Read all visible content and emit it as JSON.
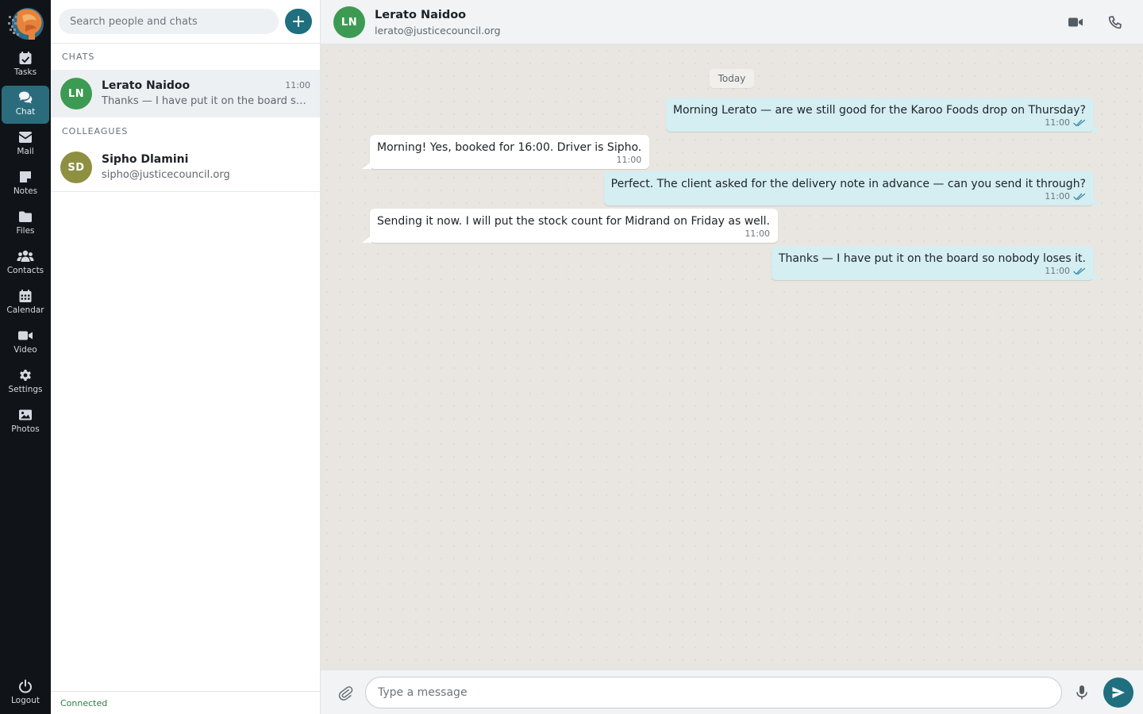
{
  "nav": {
    "items": [
      {
        "label": "Tasks",
        "icon": "tasks-icon"
      },
      {
        "label": "Chat",
        "icon": "chat-icon",
        "active": true
      },
      {
        "label": "Mail",
        "icon": "mail-icon"
      },
      {
        "label": "Notes",
        "icon": "notes-icon"
      },
      {
        "label": "Files",
        "icon": "folder-icon"
      },
      {
        "label": "Contacts",
        "icon": "contacts-icon"
      },
      {
        "label": "Calendar",
        "icon": "calendar-icon"
      },
      {
        "label": "Video",
        "icon": "video-icon"
      },
      {
        "label": "Settings",
        "icon": "gear-icon"
      },
      {
        "label": "Photos",
        "icon": "image-icon"
      }
    ],
    "logout_label": "Logout"
  },
  "list": {
    "search_placeholder": "Search people and chats",
    "chats_heading": "CHATS",
    "colleagues_heading": "COLLEAGUES",
    "chats": [
      {
        "initials": "LN",
        "name": "Lerato Naidoo",
        "time": "11:00",
        "preview": "Thanks — I have put it on the board so nobody loses it.",
        "avatar_color": "#3d9a52"
      }
    ],
    "colleagues": [
      {
        "initials": "SD",
        "name": "Sipho Dlamini",
        "email": "sipho@justicecouncil.org",
        "avatar_color": "#8f8f42"
      }
    ],
    "status": "Connected"
  },
  "conversation": {
    "initials": "LN",
    "name": "Lerato Naidoo",
    "email": "lerato@justicecouncil.org",
    "avatar_color": "#3d9a52",
    "day_label": "Today",
    "messages": [
      {
        "direction": "out",
        "text": "Morning Lerato — are we still good for the Karoo Foods drop on Thursday?",
        "time": "11:00"
      },
      {
        "direction": "in",
        "text": "Morning! Yes, booked for 16:00. Driver is Sipho.",
        "time": "11:00"
      },
      {
        "direction": "out",
        "text": "Perfect. The client asked for the delivery note in advance — can you send it through?",
        "time": "11:00"
      },
      {
        "direction": "in",
        "text": "Sending it now. I will put the stock count for Midrand on Friday as well.",
        "time": "11:00"
      },
      {
        "direction": "out",
        "text": "Thanks — I have put it on the board so nobody loses it.",
        "time": "11:00"
      }
    ],
    "composer_placeholder": "Type a message"
  },
  "colors": {
    "accent": "#1f6f7f",
    "rail": "#101418",
    "outgoing_bubble": "#d4eef2",
    "incoming_bubble": "#ffffff",
    "connected": "#2f7d3a"
  }
}
